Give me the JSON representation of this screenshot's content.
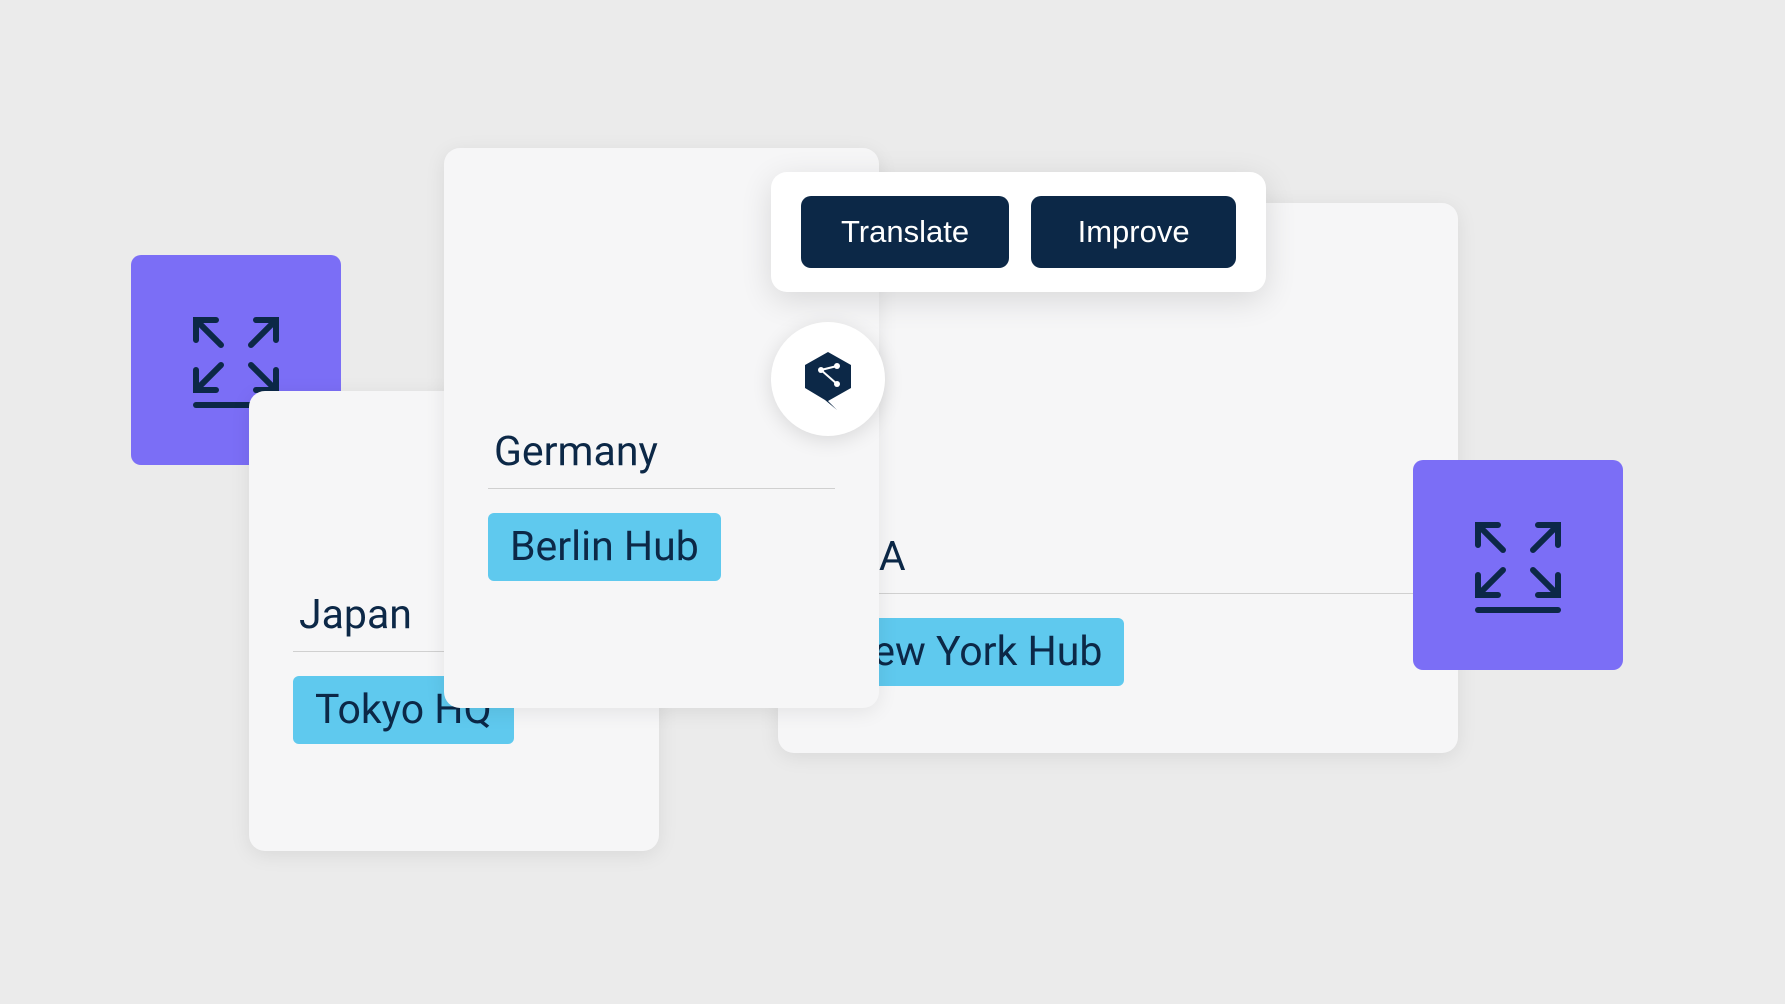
{
  "toolbar": {
    "translate_label": "Translate",
    "improve_label": "Improve"
  },
  "cards": {
    "japan": {
      "country": "Japan",
      "hub": "Tokyo HQ"
    },
    "germany": {
      "country": "Germany",
      "hub": "Berlin Hub"
    },
    "usa": {
      "country": "USA",
      "hub": "New York Hub"
    }
  },
  "colors": {
    "accent_purple": "#7b6ef6",
    "tag_blue": "#5fc9ee",
    "dark_navy": "#0c2847"
  }
}
